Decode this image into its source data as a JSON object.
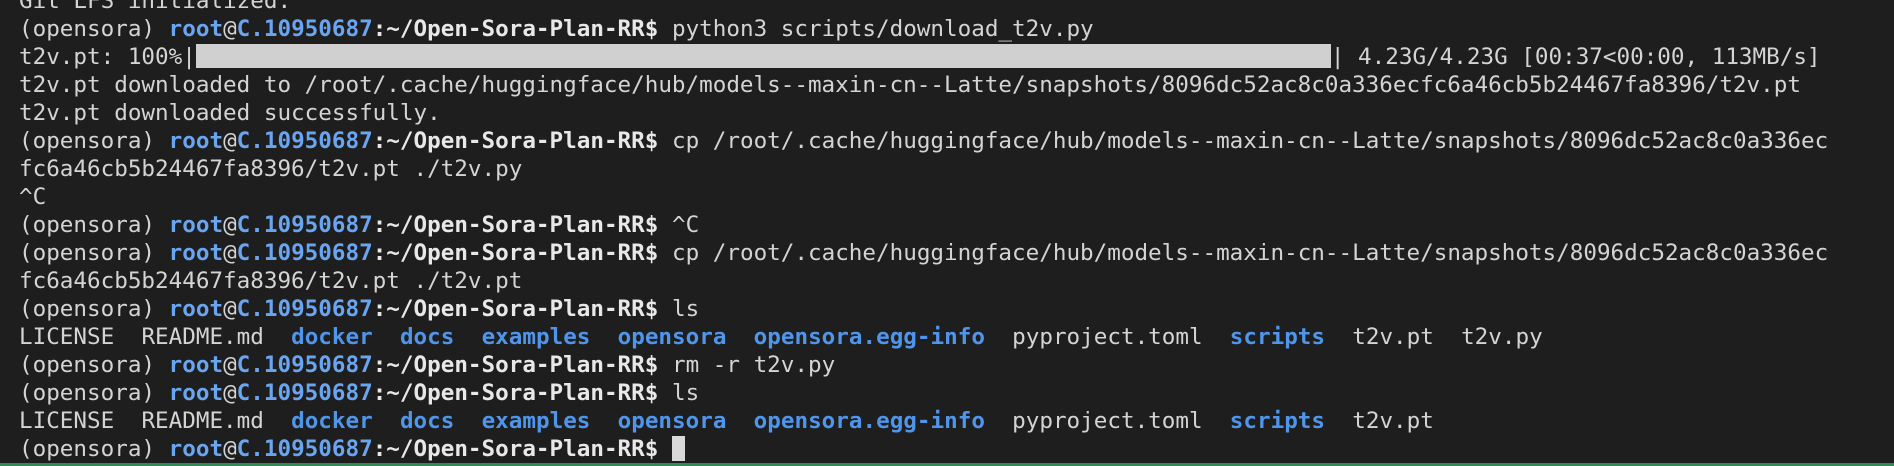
{
  "terminal": {
    "prompt": {
      "env": "(opensora) ",
      "user": "root",
      "at": "@",
      "host": "C.10950687",
      "path": ":~/Open-Sora-Plan-RR$",
      "sigil": " "
    },
    "lines": {
      "l0": "Git LFS initialized.",
      "l1_cmd": "python3 scripts/download_t2v.py",
      "l2_prefix": "t2v.pt: 100%|",
      "l2_suffix": "| 4.23G/4.23G [00:37<00:00, 113MB/s]",
      "l3": "t2v.pt downloaded to /root/.cache/huggingface/hub/models--maxin-cn--Latte/snapshots/8096dc52ac8c0a336ecfc6a46cb5b24467fa8396/t2v.pt",
      "l4": "t2v.pt downloaded successfully.",
      "l5_cmd": "cp /root/.cache/huggingface/hub/models--maxin-cn--Latte/snapshots/8096dc52ac8c0a336ec",
      "l6": "fc6a46cb5b24467fa8396/t2v.pt ./t2v.py",
      "l7": "^C",
      "l8_cmd": "^C",
      "l9_cmd": "cp /root/.cache/huggingface/hub/models--maxin-cn--Latte/snapshots/8096dc52ac8c0a336ec",
      "l10": "fc6a46cb5b24467fa8396/t2v.pt ./t2v.pt",
      "l11_cmd": "ls",
      "l13_cmd": "rm -r t2v.py",
      "l14_cmd": "ls"
    },
    "ls1": {
      "license": "LICENSE",
      "readme": "README.md",
      "docker": "docker",
      "docs": "docs",
      "examples": "examples",
      "opensora": "opensora",
      "egginfo": "opensora.egg-info",
      "pyproject": "pyproject.toml",
      "scripts": "scripts",
      "t2vpt": "t2v.pt",
      "t2vpy": "t2v.py"
    },
    "ls2": {
      "license": "LICENSE",
      "readme": "README.md",
      "docker": "docker",
      "docs": "docs",
      "examples": "examples",
      "opensora": "opensora",
      "egginfo": "opensora.egg-info",
      "pyproject": "pyproject.toml",
      "scripts": "scripts",
      "t2vpt": "t2v.pt"
    },
    "download_progress_percent": 100
  },
  "colors": {
    "background": "#1e1e1e",
    "text": "#d4d4d4",
    "prompt_user_host": "#6aa5f1",
    "directory": "#4f95ea",
    "progress_bar": "#d0d0d0",
    "bottom_accent": "#2e8b57"
  }
}
